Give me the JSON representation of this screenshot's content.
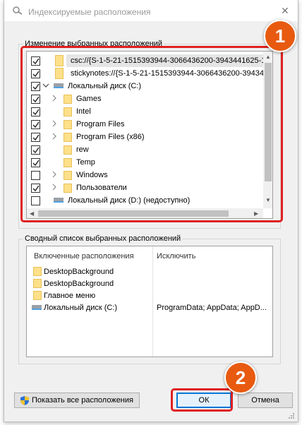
{
  "window": {
    "title": "Индексируемые расположения",
    "close_glyph": "✕"
  },
  "selected_group": {
    "label": "Изменение выбранных расположений",
    "rows": [
      {
        "label": "csc://{S-1-5-21-1515393944-3066436200-3943441625-1",
        "checked": true,
        "icon": "folder-icon",
        "expander": "none"
      },
      {
        "label": "stickynotes://{S-1-5-21-1515393944-3066436200-394344",
        "checked": true,
        "icon": "folder-icon",
        "expander": "none"
      },
      {
        "label": "Локальный диск (C:)",
        "checked": true,
        "icon": "drive-icon",
        "expander": "expanded"
      },
      {
        "label": "Games",
        "checked": true,
        "icon": "folder-icon",
        "expander": "collapsed"
      },
      {
        "label": "Intel",
        "checked": true,
        "icon": "folder-icon",
        "expander": "none"
      },
      {
        "label": "Program Files",
        "checked": true,
        "icon": "folder-icon",
        "expander": "collapsed"
      },
      {
        "label": "Program Files (x86)",
        "checked": true,
        "icon": "folder-icon",
        "expander": "collapsed"
      },
      {
        "label": "rew",
        "checked": true,
        "icon": "folder-icon",
        "expander": "none"
      },
      {
        "label": "Temp",
        "checked": true,
        "icon": "folder-icon",
        "expander": "none"
      },
      {
        "label": "Windows",
        "checked": false,
        "icon": "folder-icon",
        "expander": "collapsed"
      },
      {
        "label": "Пользователи",
        "checked": true,
        "icon": "folder-icon",
        "expander": "collapsed"
      },
      {
        "label": "Локальный диск (D:) (недоступно)",
        "checked": false,
        "icon": "drive-icon",
        "expander": "none"
      }
    ]
  },
  "summary_group": {
    "label": "Сводный список выбранных расположений",
    "col_included": "Включенные расположения",
    "col_exclude": "Исключить",
    "rows": [
      {
        "included": "DesktopBackground",
        "exclude": "",
        "icon": "folder-icon"
      },
      {
        "included": "DesktopBackground",
        "exclude": "",
        "icon": "folder-icon"
      },
      {
        "included": "Главное меню",
        "exclude": "",
        "icon": "folder-icon"
      },
      {
        "included": "Локальный диск (C:)",
        "exclude": "ProgramData; AppData; AppD...",
        "icon": "drive-icon"
      }
    ]
  },
  "buttons": {
    "show_all": "Показать все расположения",
    "ok": "ОК",
    "cancel": "Отмена"
  },
  "annotations": {
    "badge1": "1",
    "badge2": "2"
  },
  "colors": {
    "annotation_red": "#e02020",
    "badge_orange": "#e85a10",
    "focus_blue": "#0078d7"
  }
}
